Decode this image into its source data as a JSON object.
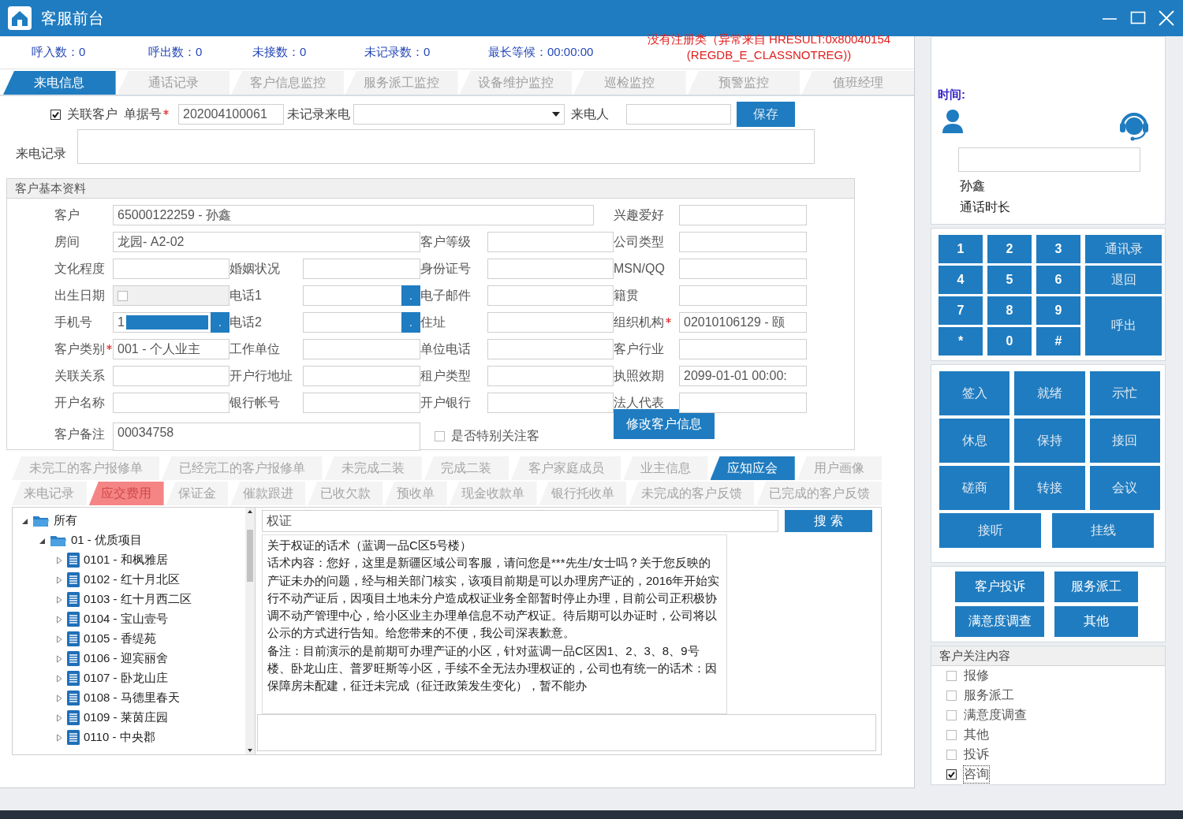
{
  "window": {
    "title": "客服前台"
  },
  "error_message": [
    "没有注册类（异常来自 HRESULT:0x80040154",
    "(REGDB_E_CLASSNOTREG))"
  ],
  "stats": [
    "呼入数：0",
    "呼出数：0",
    "未接数：0",
    "未记录数：0",
    "最长等候：00:00:00"
  ],
  "main_tabs": [
    {
      "label": "来电信息",
      "selected": true
    },
    {
      "label": "通话记录",
      "selected": false
    },
    {
      "label": "客户信息监控",
      "selected": false
    },
    {
      "label": "服务派工监控",
      "selected": false
    },
    {
      "label": "设备维护监控",
      "selected": false
    },
    {
      "label": "巡检监控",
      "selected": false
    },
    {
      "label": "预警监控",
      "selected": false
    },
    {
      "label": "值班经理",
      "selected": false
    }
  ],
  "call_form": {
    "link_customer": {
      "label": "关联客户",
      "checked": true
    },
    "ticket": {
      "label": "单据号",
      "required": true,
      "value": "202004100061"
    },
    "unrecorded": {
      "label": "未记录来电"
    },
    "caller": {
      "label": "来电人"
    },
    "save_button": "保存",
    "record": {
      "label": "来电记录"
    }
  },
  "customer_info": {
    "title": "客户基本资料",
    "rows": [
      [
        {
          "label": "客户",
          "kind": "long",
          "value": "65000122259 - 孙鑫",
          "required": false
        },
        "",
        "",
        {
          "label": "兴趣爱好",
          "kind": "text",
          "required": false
        }
      ],
      [
        {
          "label": "房间",
          "kind": "medium",
          "value": "龙园- A2-02",
          "required": false
        },
        "",
        {
          "label": "客户等级",
          "kind": "text",
          "required": false
        },
        {
          "label": "公司类型",
          "kind": "text",
          "required": false
        }
      ],
      [
        {
          "label": "文化程度",
          "kind": "text",
          "required": false
        },
        {
          "label": "婚姻状况",
          "kind": "text",
          "required": false
        },
        {
          "label": "身份证号",
          "kind": "text",
          "required": false
        },
        {
          "label": "MSN/QQ",
          "kind": "text",
          "required": false
        }
      ],
      [
        {
          "label": "出生日期",
          "kind": "date",
          "checked": false,
          "required": false
        },
        {
          "label": "电话1",
          "kind": "picker",
          "button": ".",
          "required": false
        },
        {
          "label": "电子邮件",
          "kind": "text",
          "required": false
        },
        {
          "label": "籍贯",
          "kind": "text",
          "required": false
        }
      ],
      [
        {
          "label": "手机号",
          "kind": "masked",
          "value": "1",
          "button": ".",
          "required": false
        },
        {
          "label": "电话2",
          "kind": "picker",
          "button": ".",
          "required": false
        },
        {
          "label": "住址",
          "kind": "text",
          "required": false
        },
        {
          "label": "组织机构",
          "kind": "text",
          "value": "02010106129 - 颐",
          "required": true
        }
      ],
      [
        {
          "label": "客户类别",
          "kind": "text",
          "value": "001 - 个人业主",
          "required": true
        },
        {
          "label": "工作单位",
          "kind": "text",
          "required": false
        },
        {
          "label": "单位电话",
          "kind": "text",
          "required": false
        },
        {
          "label": "客户行业",
          "kind": "text",
          "required": false
        }
      ],
      [
        {
          "label": "关联关系",
          "kind": "text",
          "required": false
        },
        {
          "label": "开户行地址",
          "kind": "text",
          "required": false
        },
        {
          "label": "租户类型",
          "kind": "text",
          "required": false
        },
        {
          "label": "执照效期",
          "kind": "text",
          "value": "2099-01-01 00:00:",
          "required": false
        }
      ],
      [
        {
          "label": "开户名称",
          "kind": "text",
          "required": false
        },
        {
          "label": "银行帐号",
          "kind": "text",
          "required": false
        },
        {
          "label": "开户银行",
          "kind": "text",
          "required": false
        },
        {
          "label": "法人代表",
          "kind": "text",
          "required": false
        }
      ]
    ],
    "remark": {
      "label": "客户备注",
      "value": "00034758"
    },
    "special": {
      "label": "是否特别关注客",
      "checked": false
    },
    "edit_button": "修改客户信息"
  },
  "sub_tabs": [
    [
      {
        "label": "未完工的客户报修单",
        "selected": false,
        "flagged": false
      },
      {
        "label": "已经完工的客户报修单",
        "selected": false,
        "flagged": false
      },
      {
        "label": "未完成二装",
        "selected": false,
        "flagged": false
      },
      {
        "label": "完成二装",
        "selected": false,
        "flagged": false
      },
      {
        "label": "客户家庭成员",
        "selected": false,
        "flagged": false
      },
      {
        "label": "业主信息",
        "selected": false,
        "flagged": false
      },
      {
        "label": "应知应会",
        "selected": true,
        "flagged": false
      },
      {
        "label": "用户画像",
        "selected": false,
        "flagged": false
      }
    ],
    [
      {
        "label": "来电记录",
        "selected": false,
        "flagged": false
      },
      {
        "label": "应交费用",
        "selected": false,
        "flagged": true
      },
      {
        "label": "保证金",
        "selected": false,
        "flagged": false
      },
      {
        "label": "催款跟进",
        "selected": false,
        "flagged": false
      },
      {
        "label": "已收欠款",
        "selected": false,
        "flagged": false
      },
      {
        "label": "预收单",
        "selected": false,
        "flagged": false
      },
      {
        "label": "现金收款单",
        "selected": false,
        "flagged": false
      },
      {
        "label": "银行托收单",
        "selected": false,
        "flagged": false
      },
      {
        "label": "未完成的客户反馈",
        "selected": false,
        "flagged": false
      },
      {
        "label": "已完成的客户反馈",
        "selected": false,
        "flagged": false
      }
    ]
  ],
  "tree": [
    {
      "label": "所有",
      "kind": "folder",
      "expanded": true,
      "children": [
        {
          "label": "01 - 优质项目",
          "kind": "folder",
          "expanded": true,
          "children": [
            {
              "label": "0101 - 和枫雅居",
              "kind": "doc",
              "expanded": false
            },
            {
              "label": "0102 - 红十月北区",
              "kind": "doc",
              "expanded": false
            },
            {
              "label": "0103 - 红十月西二区",
              "kind": "doc",
              "expanded": false
            },
            {
              "label": "0104 - 宝山壹号",
              "kind": "doc",
              "expanded": false
            },
            {
              "label": "0105 - 香缇苑",
              "kind": "doc",
              "expanded": false
            },
            {
              "label": "0106 - 迎宾丽舍",
              "kind": "doc",
              "expanded": false
            },
            {
              "label": "0107 - 卧龙山庄",
              "kind": "doc",
              "expanded": false
            },
            {
              "label": "0108 - 马德里春天",
              "kind": "doc",
              "expanded": false
            },
            {
              "label": "0109 - 莱茵庄园",
              "kind": "doc",
              "expanded": false
            },
            {
              "label": "0110 - 中央郡",
              "kind": "doc",
              "expanded": false
            }
          ]
        }
      ]
    }
  ],
  "search": {
    "value": "权证",
    "button": "搜 索"
  },
  "script_text": [
    "关于权证的话术（蓝调一品C区5号楼）",
    "话术内容：您好，这里是新疆区域公司客服，请问您是***先生/女士吗？关于您反映的产证未办的问题，经与相关部门核实，该项目前期是可以办理房产证的，2016年开始实行不动产证后，因项目土地未分户造成权证业务全部暂时停止办理，目前公司正积极协调不动产管理中心，给小区业主办理单信息不动产权证。待后期可以办证时，公司将以公示的方式进行告知。给您带来的不便，我公司深表歉意。",
    "备注：目前演示的是前期可办理产证的小区，针对蓝调一品C区因1、2、3、8、9号楼、卧龙山庄、普罗旺斯等小区，手续不全无法办理权证的，公司也有统一的话术：因保障房未配建，征迁未完成（征迁政策发生变化），暂不能办"
  ],
  "agent_panel": {
    "time_label": "时间:",
    "name": "孙鑫",
    "duration_label": "通话时长",
    "keypad": [
      {
        "label": "1",
        "kind": "digit"
      },
      {
        "label": "2",
        "kind": "digit"
      },
      {
        "label": "3",
        "kind": "digit"
      },
      {
        "label": "通讯录",
        "kind": "function"
      },
      {
        "label": "4",
        "kind": "digit"
      },
      {
        "label": "5",
        "kind": "digit"
      },
      {
        "label": "6",
        "kind": "digit"
      },
      {
        "label": "退回",
        "kind": "function"
      },
      {
        "label": "7",
        "kind": "digit"
      },
      {
        "label": "8",
        "kind": "digit"
      },
      {
        "label": "9",
        "kind": "digit"
      },
      {
        "label": "呼出",
        "kind": "tall"
      },
      {
        "label": "*",
        "kind": "digit"
      },
      {
        "label": "0",
        "kind": "digit"
      },
      {
        "label": "#",
        "kind": "digit"
      }
    ],
    "controls": [
      {
        "label": "签入",
        "kind": "cell"
      },
      {
        "label": "就绪",
        "kind": "cell"
      },
      {
        "label": "示忙",
        "kind": "cell"
      },
      {
        "label": "休息",
        "kind": "cell"
      },
      {
        "label": "保持",
        "kind": "cell"
      },
      {
        "label": "接回",
        "kind": "cell"
      },
      {
        "label": "磋商",
        "kind": "cell"
      },
      {
        "label": "转接",
        "kind": "cell"
      },
      {
        "label": "会议",
        "kind": "cell"
      },
      {
        "label": "接听",
        "kind": "wide"
      },
      {
        "label": "挂线",
        "kind": "wide"
      }
    ],
    "service_buttons": [
      "客户投诉",
      "服务派工",
      "满意度调查",
      "其他"
    ],
    "focus": {
      "title": "客户关注内容",
      "items": [
        {
          "label": "报修",
          "checked": false
        },
        {
          "label": "服务派工",
          "checked": false
        },
        {
          "label": "满意度调查",
          "checked": false
        },
        {
          "label": "其他",
          "checked": false
        },
        {
          "label": "投诉",
          "checked": false
        },
        {
          "label": "咨询",
          "checked": true
        }
      ]
    }
  }
}
